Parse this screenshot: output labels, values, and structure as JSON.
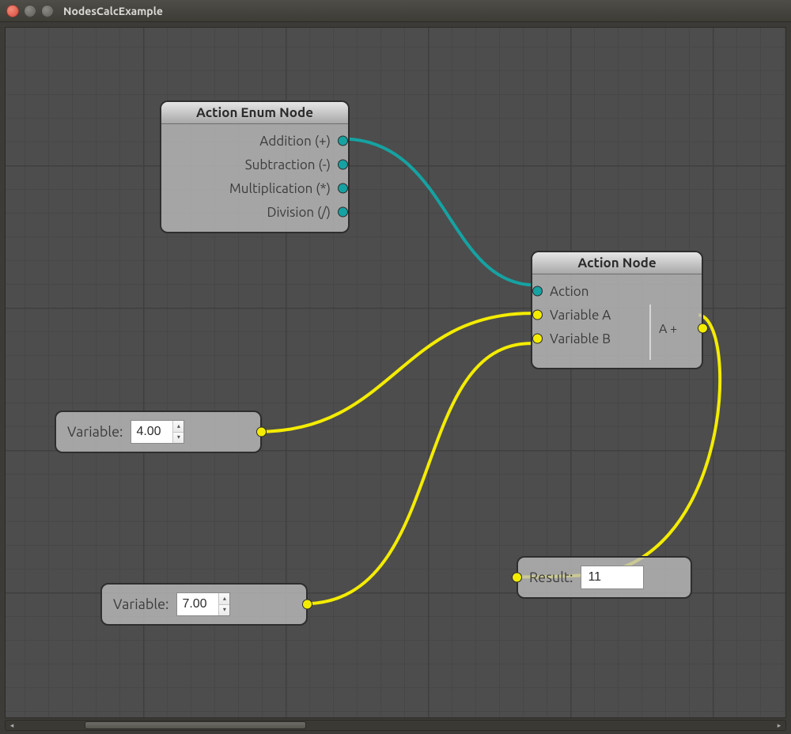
{
  "window": {
    "title": "NodesCalcExample"
  },
  "colors": {
    "teal": "#16a2a2",
    "yellow": "#f4ec00"
  },
  "nodes": {
    "enum": {
      "title": "Action Enum Node",
      "outputs": [
        "Addition (+)",
        "Subtraction (-)",
        "Multiplication (*)",
        "Division (/)"
      ]
    },
    "action": {
      "title": "Action Node",
      "inputs": [
        "Action",
        "Variable A",
        "Variable B"
      ],
      "expr": "A +"
    }
  },
  "varA": {
    "label": "Variable:",
    "value": "4.00"
  },
  "varB": {
    "label": "Variable:",
    "value": "7.00"
  },
  "result": {
    "label": "Result:",
    "value": "11"
  }
}
